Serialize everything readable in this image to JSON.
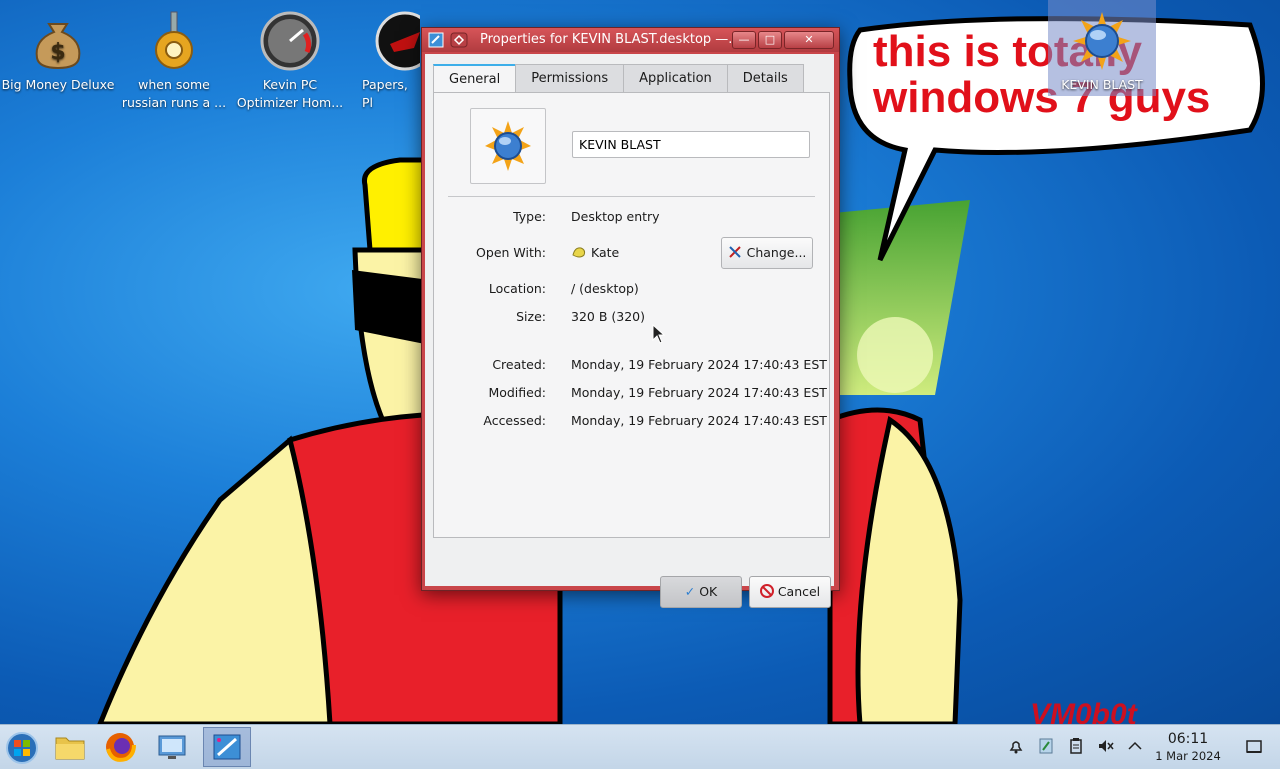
{
  "desktop": {
    "icons": [
      {
        "label": "Big Money Deluxe",
        "icon": "money-bag-icon"
      },
      {
        "label": "when some russian runs a ...",
        "icon": "golden-gear-icon"
      },
      {
        "label": "Kevin PC Optimizer Hom...",
        "icon": "speedometer-icon"
      },
      {
        "label": "Papers, Pl",
        "icon": "red-emblem-icon"
      },
      {
        "label": "KEVIN BLAST",
        "icon": "sun-globe-icon"
      }
    ],
    "speech_bubble": "this is totally windows 7 guys",
    "watermark": "VM0b0t"
  },
  "window": {
    "title": "Properties for KEVIN BLAST.desktop —...",
    "tabs": [
      "General",
      "Permissions",
      "Application",
      "Details"
    ],
    "name_value": "KEVIN BLAST",
    "labels": {
      "type": "Type:",
      "open_with": "Open With:",
      "location": "Location:",
      "size": "Size:",
      "created": "Created:",
      "modified": "Modified:",
      "accessed": "Accessed:"
    },
    "values": {
      "type": "Desktop entry",
      "open_with": "Kate",
      "location": "/ (desktop)",
      "size": "320 B (320)",
      "created": "Monday, 19 February 2024 17:40:43 EST",
      "modified": "Monday, 19 February 2024 17:40:43 EST",
      "accessed": "Monday, 19 February 2024 17:40:43 EST"
    },
    "change_label": "Change...",
    "ok_label": "OK",
    "cancel_label": "Cancel"
  },
  "taskbar": {
    "apps": [
      "start-menu-icon",
      "file-manager-icon",
      "firefox-icon",
      "system-settings-icon",
      "properties-window-icon"
    ],
    "clock_time": "06:11",
    "clock_date": "1 Mar 2024"
  },
  "colors": {
    "titlebar": "#c9464a",
    "accent": "#3daee9",
    "desktop_blue": "#1c7fd8"
  }
}
